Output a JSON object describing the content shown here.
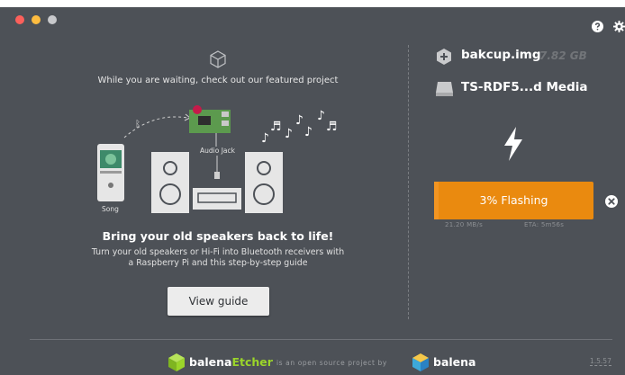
{
  "window": {
    "controls": [
      "close",
      "minimize",
      "zoom"
    ]
  },
  "header": {
    "icons": [
      "help-icon",
      "settings-gear-icon"
    ]
  },
  "featured": {
    "caption": "While you are waiting, check out our featured project",
    "illustration": {
      "song_label": "Song",
      "jack_label": "Audio Jack"
    },
    "title": "Bring your old speakers back to life!",
    "body": "Turn your old speakers or Hi-Fi into Bluetooth receivers with a Raspberry Pi and this step-by-step guide",
    "button_label": "View guide"
  },
  "image": {
    "name": "bakcup.img",
    "size": "7.82 GB"
  },
  "drive": {
    "name": "TS-RDF5...d Media"
  },
  "flash": {
    "progress_label": "3% Flashing",
    "progress_percent": 3,
    "speed": "21.20 MB/s",
    "eta": "ETA: 5m56s",
    "accent": "#ea8a0f"
  },
  "footer": {
    "brand_prefix": "balena",
    "brand_accent": "Etcher",
    "tagline": "is an open source project by",
    "company": "balena",
    "version": "1.5.57"
  }
}
